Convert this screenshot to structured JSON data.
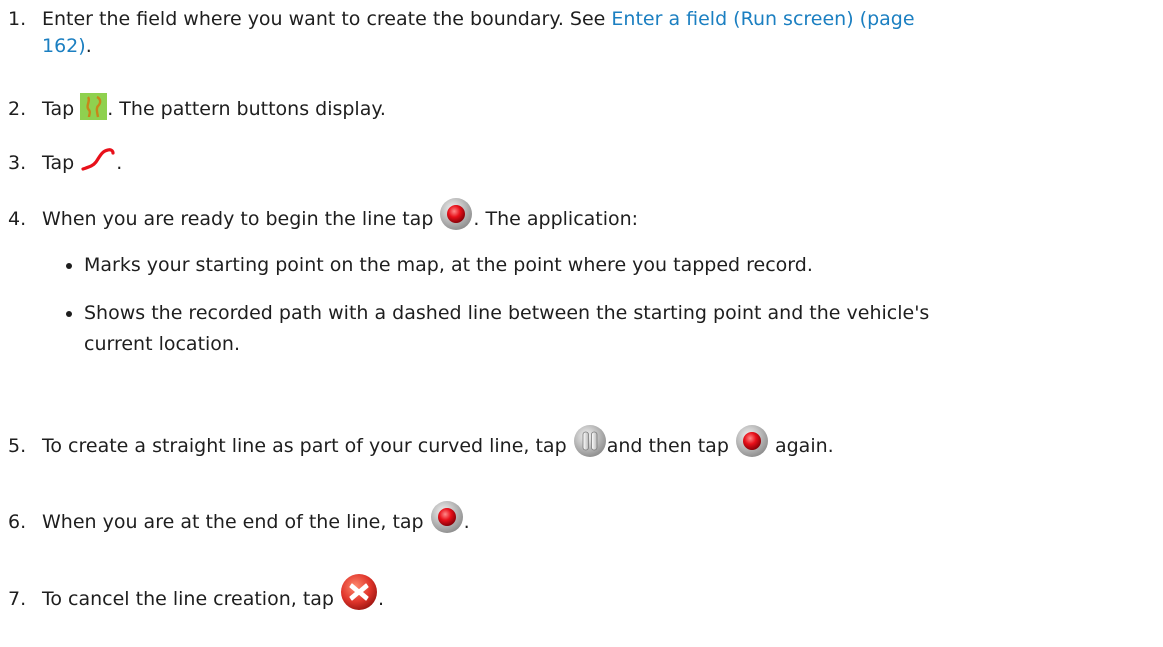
{
  "steps": [
    {
      "number": "1.",
      "text_before": "Enter the field where you want to create the boundary. See ",
      "link_text": "Enter a field (Run screen) (page",
      "link_text_2": "162)",
      "text_after": "."
    },
    {
      "number": "2.",
      "text_before": "Tap ",
      "icon": "pattern-buttons-icon",
      "text_after": ". The pattern buttons display."
    },
    {
      "number": "3.",
      "text_before": "Tap ",
      "icon": "curve-line-icon",
      "text_after": "."
    },
    {
      "number": "4.",
      "text_before": "When you are ready to begin the line tap ",
      "icon": "record-icon",
      "text_after": ". The application:",
      "bullets": [
        "Marks your starting point on the map, at the point where you tapped record.",
        "Shows the recorded path with a dashed line between the starting point and the vehicle's",
        "current location."
      ]
    },
    {
      "number": "5.",
      "text_before": "To create a straight line as part of your curved line, tap ",
      "icon": "pause-icon",
      "text_middle": "and then tap ",
      "icon_2": "record-icon",
      "text_after": " again."
    },
    {
      "number": "6.",
      "text_before": "When you are at the end of the line, tap ",
      "icon": "record-icon",
      "text_after": "."
    },
    {
      "number": "7.",
      "text_before": "To cancel the line creation, tap ",
      "icon": "cancel-icon",
      "text_after": "."
    }
  ],
  "colors": {
    "link": "#1b7fc1",
    "text": "#1e1e1e",
    "pattern_icon_bg": "#8fd14f",
    "record_red": "#e8101a",
    "cancel_red": "#e0352b"
  }
}
